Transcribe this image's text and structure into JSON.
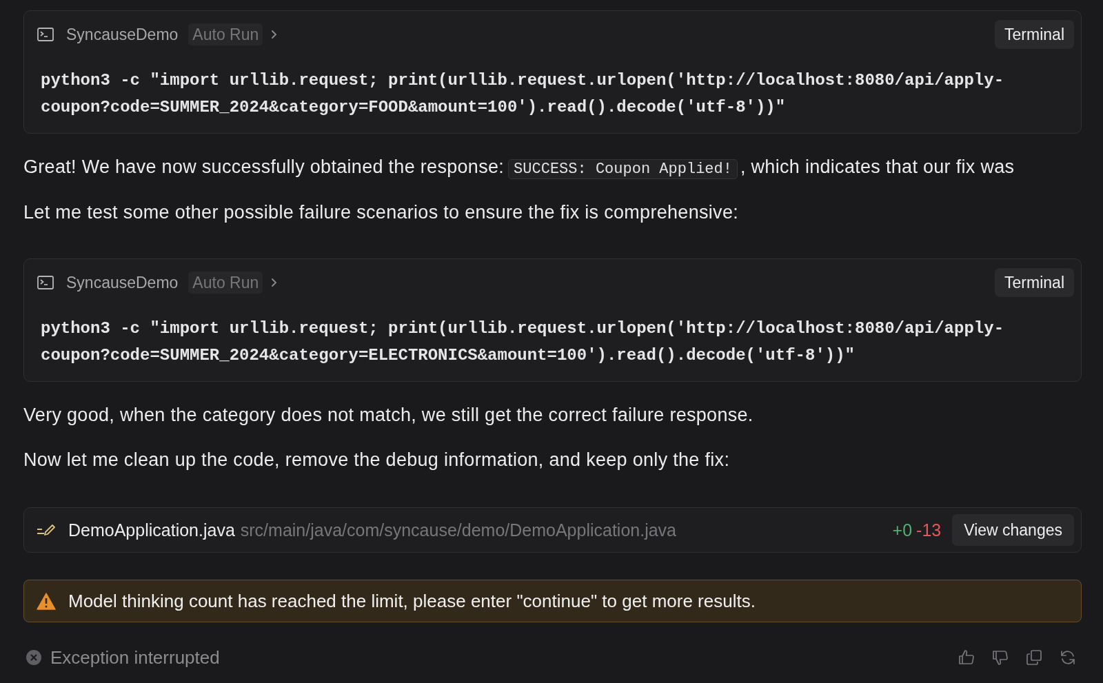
{
  "blocks": [
    {
      "kind": "terminal",
      "project": "SyncauseDemo",
      "mode": "Auto Run",
      "button": "Terminal",
      "command": "python3 -c \"import urllib.request; print(urllib.request.urlopen('http://localhost:8080/api/apply-coupon?code=SUMMER_2024&category=FOOD&amount=100').read().decode('utf-8'))\""
    },
    {
      "kind": "paragraph",
      "parts": [
        {
          "kind": "text",
          "text": "Great! We have now successfully obtained the response:"
        },
        {
          "kind": "code",
          "text": "SUCCESS: Coupon Applied!"
        },
        {
          "kind": "text",
          "text": ", which indicates that our fix was"
        }
      ]
    },
    {
      "kind": "paragraph",
      "parts": [
        {
          "kind": "text",
          "text": "Let me test some other possible failure scenarios to ensure the fix is comprehensive:"
        }
      ]
    },
    {
      "kind": "terminal",
      "project": "SyncauseDemo",
      "mode": "Auto Run",
      "button": "Terminal",
      "command": "python3 -c \"import urllib.request; print(urllib.request.urlopen('http://localhost:8080/api/apply-coupon?code=SUMMER_2024&category=ELECTRONICS&amount=100').read().decode('utf-8'))\""
    },
    {
      "kind": "paragraph",
      "parts": [
        {
          "kind": "text",
          "text": "Very good, when the category does not match, we still get the correct failure response."
        }
      ]
    },
    {
      "kind": "paragraph",
      "parts": [
        {
          "kind": "text",
          "text": "Now let me clean up the code, remove the debug information, and keep only the fix:"
        }
      ]
    },
    {
      "kind": "file_change",
      "file_name": "DemoApplication.java",
      "path": "src/main/java/com/syncause/demo/DemoApplication.java",
      "additions": "+0",
      "deletions": "-13",
      "button": "View changes"
    },
    {
      "kind": "warning",
      "text": "Model thinking count has reached the limit, please enter \"continue\" to get more results."
    }
  ],
  "status": {
    "text": "Exception interrupted"
  }
}
